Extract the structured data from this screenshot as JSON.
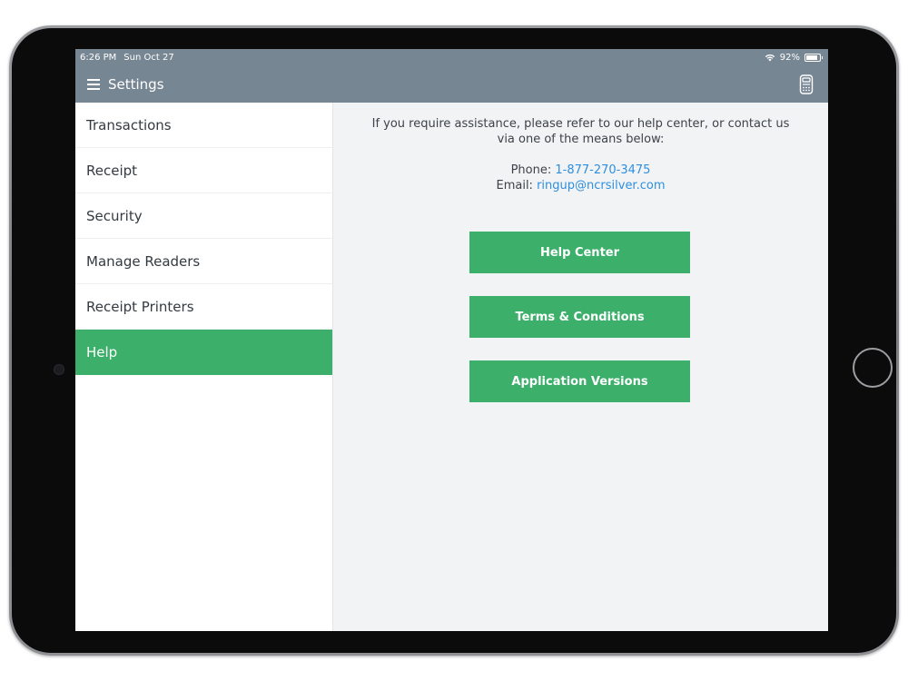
{
  "status_bar": {
    "time": "6:26 PM",
    "date": "Sun Oct 27",
    "battery": "92%"
  },
  "header": {
    "title": "Settings",
    "menu_icon": "hamburger-menu-icon",
    "reader_icon": "card-reader-icon"
  },
  "sidebar": {
    "items": [
      {
        "label": "Transactions",
        "active": false
      },
      {
        "label": "Receipt",
        "active": false
      },
      {
        "label": "Security",
        "active": false
      },
      {
        "label": "Manage Readers",
        "active": false
      },
      {
        "label": "Receipt Printers",
        "active": false
      },
      {
        "label": "Help",
        "active": true
      }
    ]
  },
  "help": {
    "intro": "If you require assistance, please refer to our help center, or contact us via one of the means below:",
    "phone_label": "Phone:",
    "phone_value": "1-877-270-3475",
    "email_label": "Email:",
    "email_value": "ringup@ncrsilver.com",
    "buttons": {
      "help_center": "Help Center",
      "terms": "Terms & Conditions",
      "versions": "Application Versions"
    }
  },
  "colors": {
    "accent": "#3cb06b",
    "header": "#778693",
    "link": "#2e8fe0"
  }
}
